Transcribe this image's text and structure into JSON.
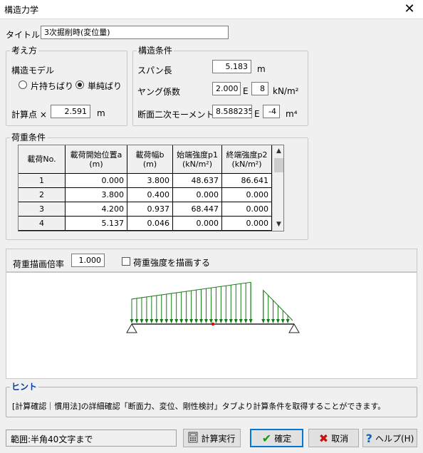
{
  "window": {
    "title": "構造力学",
    "close_icon": "close-icon"
  },
  "title_field": {
    "label": "タイトル",
    "value": "3次掘削時(変位量)"
  },
  "approach": {
    "legend": "考え方",
    "model_label": "構造モデル",
    "options": [
      {
        "label": "片持ちばり",
        "selected": false
      },
      {
        "label": "単純ばり",
        "selected": true
      }
    ],
    "calc_point_label": "計算点 ×",
    "calc_point_value": "2.591",
    "calc_point_unit": "m"
  },
  "structure": {
    "legend": "構造条件",
    "span_label": "スパン長",
    "span_value": "5.183",
    "span_unit": "m",
    "young_label": "ヤング係数",
    "young_mantissa": "2.000",
    "young_e": "E",
    "young_exp": "8",
    "young_unit": "kN/m²",
    "moment_label": "断面二次モーメント",
    "moment_mantissa": "8.588235",
    "moment_e": "E",
    "moment_exp": "-4",
    "moment_unit": "m⁴"
  },
  "load": {
    "legend": "荷重条件",
    "headers": [
      "載荷No.",
      "載荷開始位置a\n(m)",
      "載荷幅b\n(m)",
      "始端強度p1\n(kN/m²)",
      "終端強度p2\n(kN/m²)"
    ],
    "rows": [
      [
        "1",
        "0.000",
        "3.800",
        "48.637",
        "86.641"
      ],
      [
        "2",
        "3.800",
        "0.400",
        "0.000",
        "0.000"
      ],
      [
        "3",
        "4.200",
        "0.937",
        "68.447",
        "0.000"
      ],
      [
        "4",
        "5.137",
        "0.046",
        "0.000",
        "0.000"
      ]
    ]
  },
  "drawing": {
    "scale_label": "荷重描画倍率",
    "scale_value": "1.000",
    "draw_intensity_label": "荷重強度を描画する",
    "draw_intensity_checked": false,
    "load_color": "#1a7a1a",
    "calc_point_color": "#e00000"
  },
  "hint": {
    "legend": "ヒント",
    "text": "[計算確認｜慣用法]の詳細確認「断面力、変位、剛性検討」タブより計算条件を取得することができます。"
  },
  "footer": {
    "status": "範囲:半角40文字まで",
    "calc_button": "計算実行",
    "ok_button": "確定",
    "cancel_button": "取消",
    "help_button": "ヘルプ(H)"
  }
}
